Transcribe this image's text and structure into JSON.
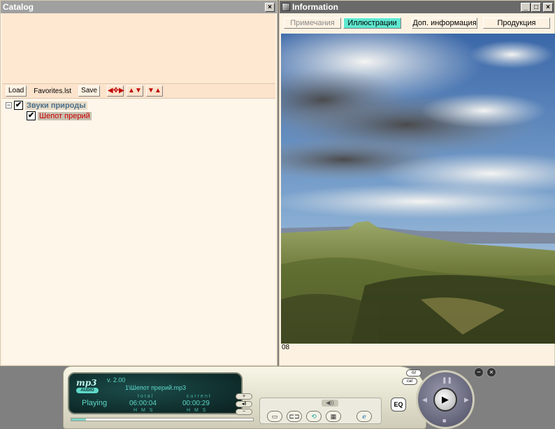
{
  "catalog": {
    "title": "Catalog",
    "close_glyph": "×",
    "toolbar": {
      "load": "Load",
      "file": "Favorites.lst",
      "save": "Save"
    },
    "tree": {
      "expander": "−",
      "check": "✔",
      "group": "Звуки природы",
      "item": "Шепот прерий"
    }
  },
  "info": {
    "title": "Information",
    "buttons": {
      "min": "_",
      "max": "□",
      "close": "×"
    },
    "tabs": [
      {
        "label": "Примечания",
        "state": "inactive"
      },
      {
        "label": "Иллюстрации",
        "state": "active"
      },
      {
        "label": "Доп. информация",
        "state": "normal"
      },
      {
        "label": "Продукция",
        "state": "normal"
      }
    ],
    "caption": "08"
  },
  "player": {
    "logo": "mp3",
    "version": "v. 2.00",
    "audio_badge": "AUDIO",
    "track": "1\\Шепот прерий.mp3",
    "status": "Playing",
    "total_label": "total",
    "total_time": "06:00:04",
    "current_label": "current",
    "current_time": "00:00:29",
    "hms": "H M S",
    "eq": "EQ",
    "progress": 0.08,
    "colors": {
      "lcd_text": "#5ed8c8",
      "active_tab": "#5ee8d0"
    }
  }
}
